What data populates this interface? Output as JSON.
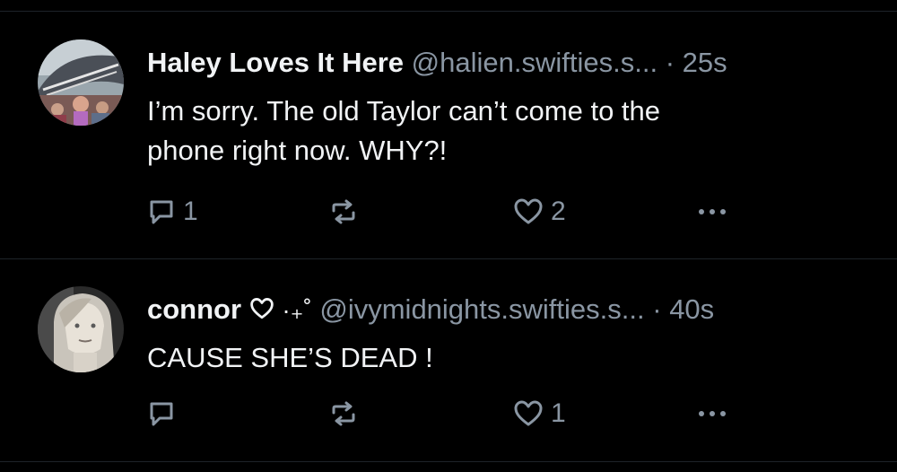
{
  "posts": [
    {
      "display_name": "Haley Loves It Here",
      "handle": "@halien.swifties.s...",
      "separator": "·",
      "timestamp": "25s",
      "text_line1": "I’m sorry. The old Taylor can’t come to the",
      "text_line2": "phone right now. WHY?!",
      "reply_count": "1",
      "like_count": "2",
      "avatar_icon": "stadium-crowd-photo"
    },
    {
      "display_name": "connor",
      "name_suffix": "·₊˚",
      "handle": "@ivymidnights.swifties.s...",
      "separator": "·",
      "timestamp": "40s",
      "text_line1": "CAUSE SHE’S DEAD !",
      "reply_count": "",
      "like_count": "1",
      "avatar_icon": "grayscale-portrait-photo"
    }
  ],
  "colors": {
    "background": "#000000",
    "text": "#f1f3f5",
    "muted": "#8a96a3",
    "divider": "#1e2329"
  }
}
